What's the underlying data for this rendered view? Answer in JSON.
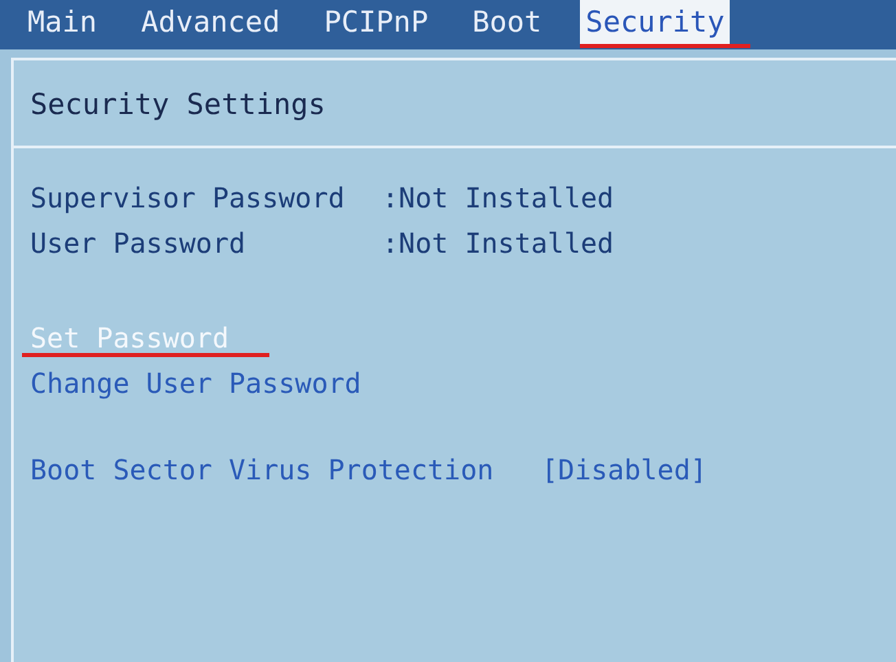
{
  "tabs": [
    {
      "label": "Main",
      "selected": false,
      "underlined": false
    },
    {
      "label": "Advanced",
      "selected": false,
      "underlined": false
    },
    {
      "label": "PCIPnP",
      "selected": false,
      "underlined": false
    },
    {
      "label": "Boot",
      "selected": false,
      "underlined": false
    },
    {
      "label": "Security",
      "selected": true,
      "underlined": true
    }
  ],
  "panel": {
    "title": "Security Settings",
    "status": [
      {
        "label": "Supervisor Password",
        "value": ":Not Installed"
      },
      {
        "label": "User Password",
        "value": ":Not Installed"
      }
    ],
    "items": [
      {
        "label": "Set Password",
        "selected": true,
        "underlined": true
      },
      {
        "label": "Change User Password",
        "selected": false,
        "underlined": false
      }
    ],
    "options": [
      {
        "label": "Boot Sector Virus Protection",
        "value": "[Disabled]"
      }
    ]
  }
}
